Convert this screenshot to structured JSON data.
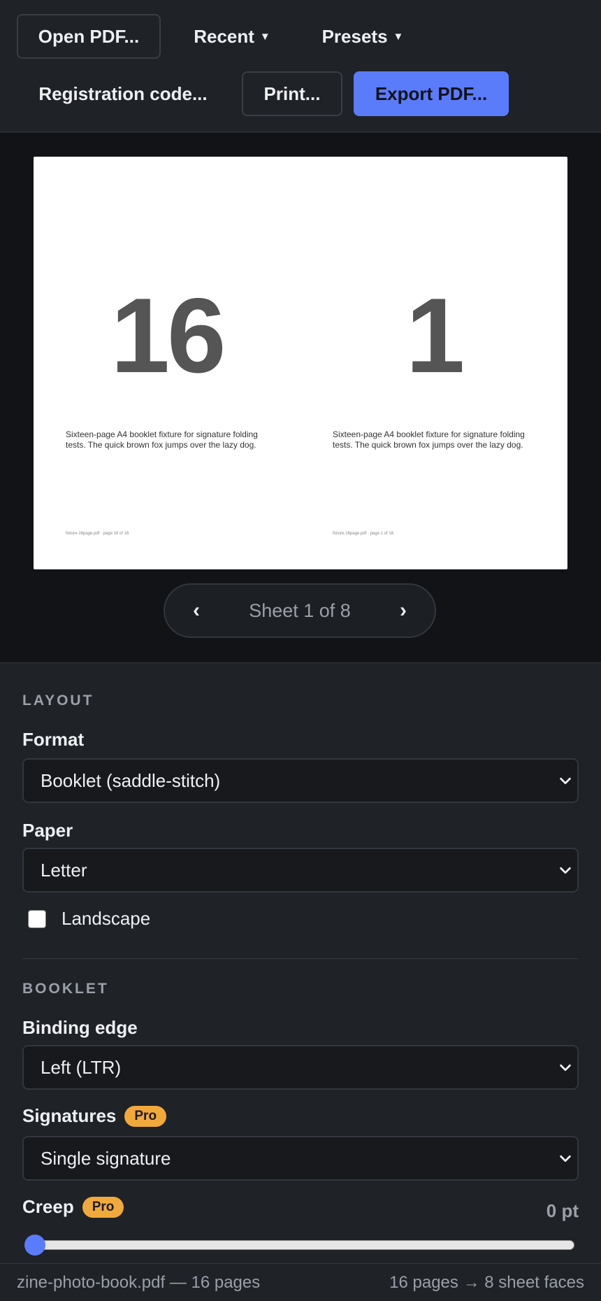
{
  "toolbar": {
    "open_label": "Open PDF...",
    "recent_label": "Recent",
    "presets_label": "Presets",
    "caret": "▼",
    "registration_label": "Registration code...",
    "print_label": "Print...",
    "export_label": "Export PDF..."
  },
  "preview": {
    "left_page": {
      "number": "16",
      "body": "Sixteen-page A4 booklet fixture for signature folding tests. The quick brown fox jumps over the lazy dog.",
      "footer": "fixture-16page.pdf · page 16 of 16"
    },
    "right_page": {
      "number": "1",
      "body": "Sixteen-page A4 booklet fixture for signature folding tests. The quick brown fox jumps over the lazy dog.",
      "footer": "fixture-16page.pdf · page 1 of 16"
    },
    "pager": {
      "prev": "‹",
      "label": "Sheet 1 of 8",
      "next": "›"
    }
  },
  "layout": {
    "section_title": "LAYOUT",
    "format_label": "Format",
    "format_value": "Booklet (saddle-stitch)",
    "paper_label": "Paper",
    "paper_value": "Letter",
    "landscape_label": "Landscape",
    "landscape_checked": false
  },
  "booklet": {
    "section_title": "BOOKLET",
    "binding_label": "Binding edge",
    "binding_value": "Left (LTR)",
    "signatures_label": "Signatures",
    "signatures_badge": "Pro",
    "signatures_value": "Single signature",
    "creep_label": "Creep",
    "creep_badge": "Pro",
    "creep_value": "0 pt",
    "creep_fraction": 0
  },
  "status": {
    "file": "zine-photo-book.pdf — 16 pages",
    "summary": "16 pages → 8 sheet faces"
  },
  "colors": {
    "accent": "#5b7cfa",
    "pro_badge": "#f2a93b",
    "background": "#1f2227"
  }
}
